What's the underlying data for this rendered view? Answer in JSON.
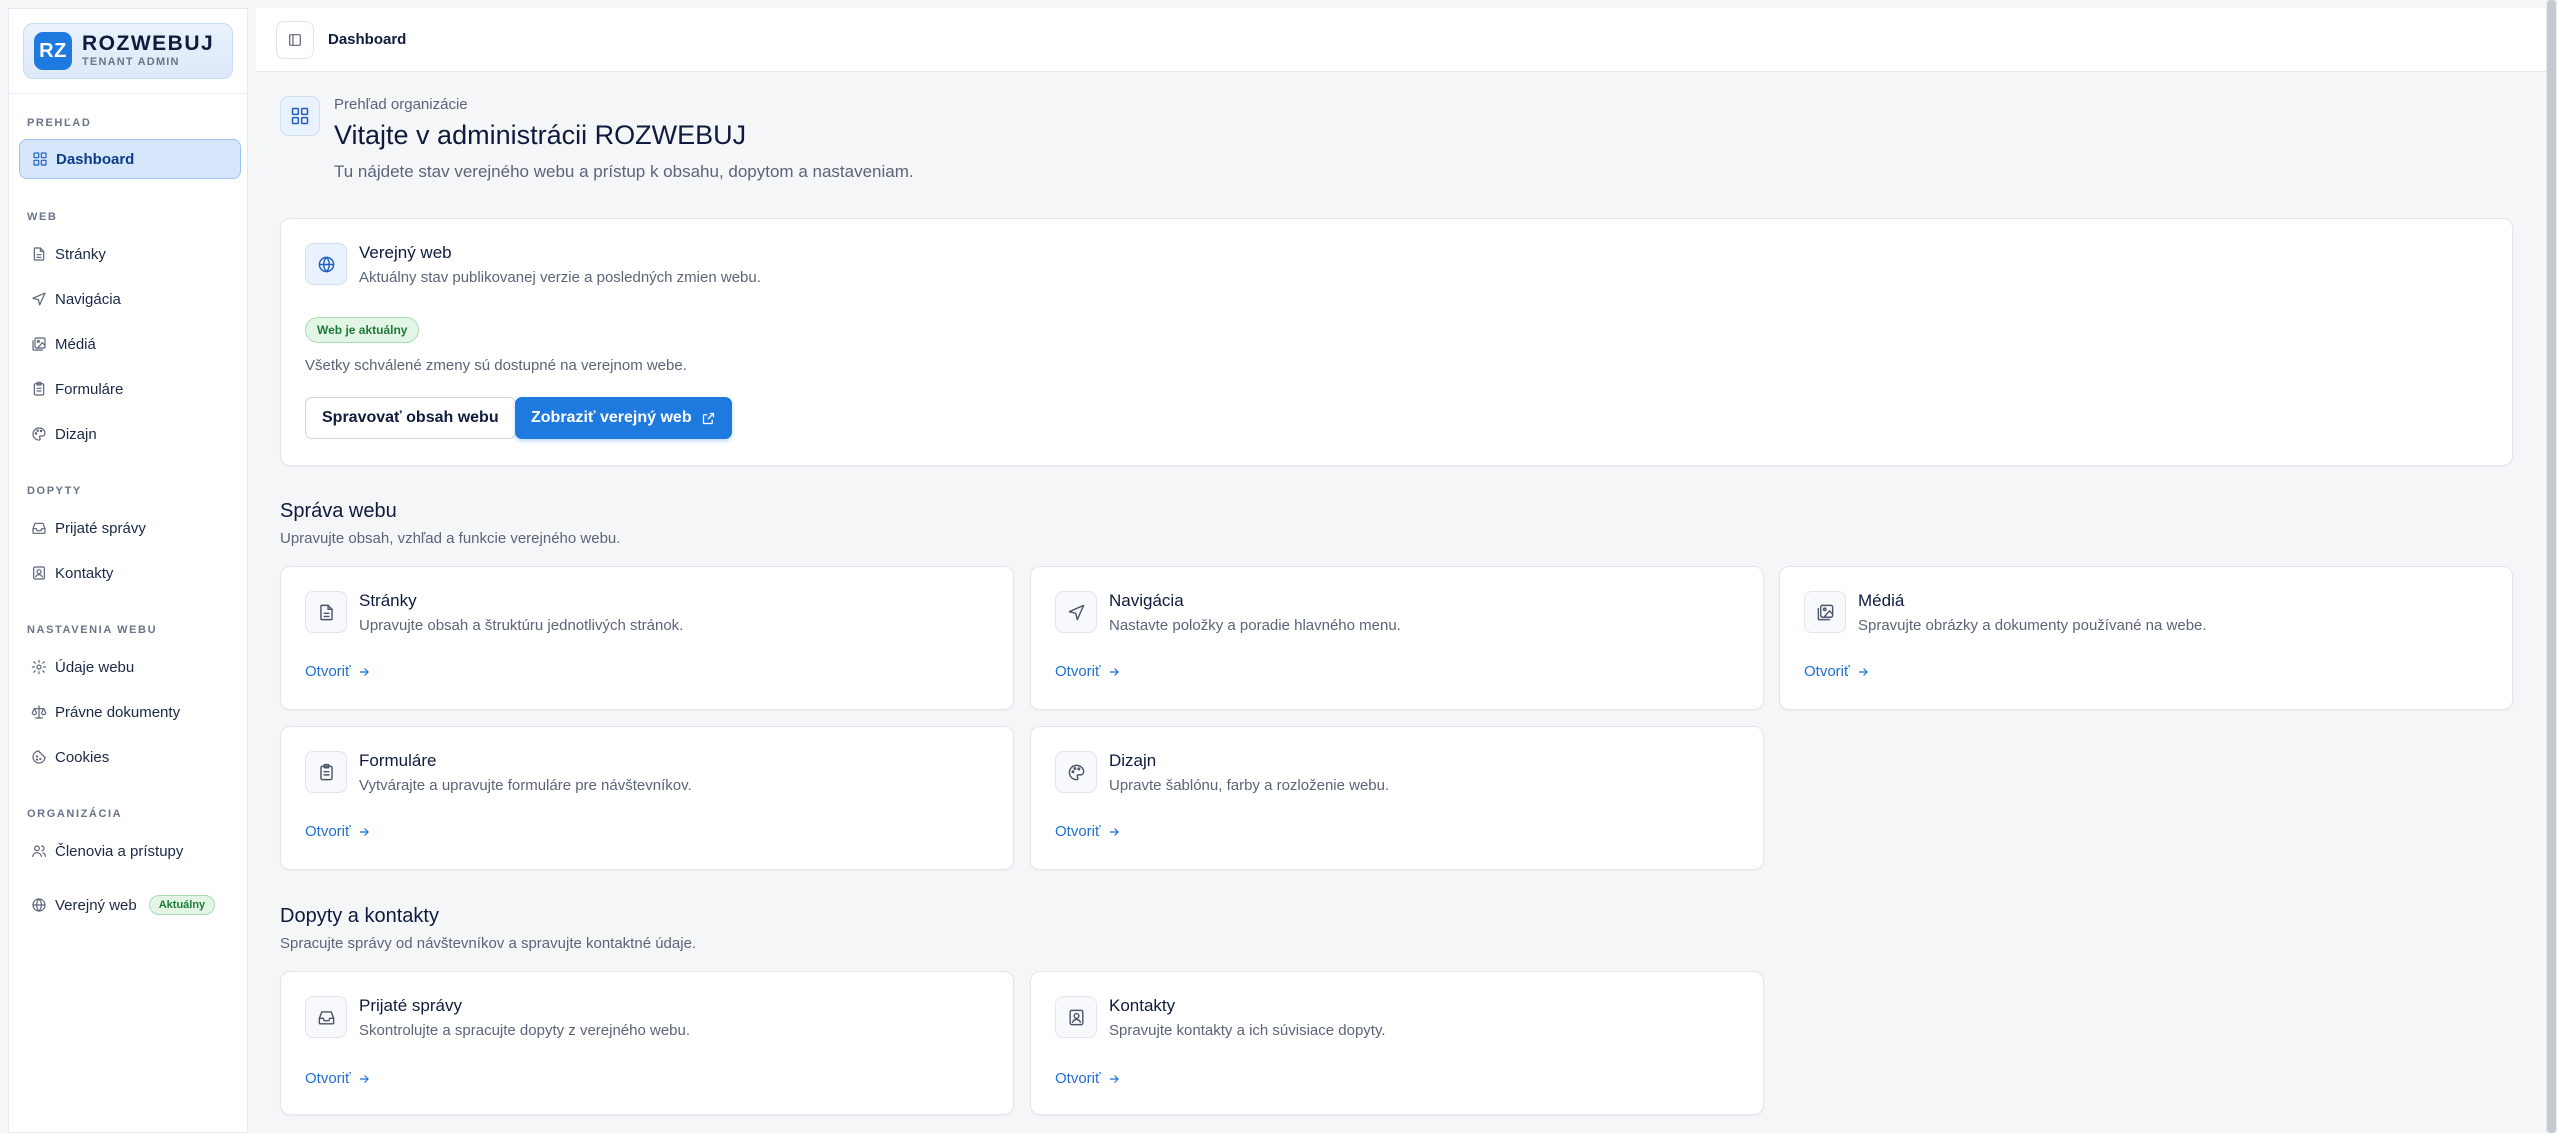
{
  "brand": {
    "logo": "RZ",
    "name": "ROZWEBUJ",
    "role": "TENANT ADMIN"
  },
  "sidebar": {
    "groups": [
      {
        "label": "PREHĽAD"
      },
      {
        "label": "WEB"
      },
      {
        "label": "DOPYTY"
      },
      {
        "label": "NASTAVENIA WEBU"
      },
      {
        "label": "ORGANIZÁCIA"
      }
    ],
    "items": [
      {
        "label": "Dashboard",
        "icon": "dashboard-grid-icon"
      },
      {
        "label": "Stránky",
        "icon": "file-icon"
      },
      {
        "label": "Navigácia",
        "icon": "navigation-icon"
      },
      {
        "label": "Médiá",
        "icon": "images-icon"
      },
      {
        "label": "Formuláre",
        "icon": "clipboard-icon"
      },
      {
        "label": "Dizajn",
        "icon": "palette-icon"
      },
      {
        "label": "Prijaté správy",
        "icon": "inbox-icon"
      },
      {
        "label": "Kontakty",
        "icon": "contact-icon"
      },
      {
        "label": "Údaje webu",
        "icon": "gear-icon"
      },
      {
        "label": "Právne dokumenty",
        "icon": "scale-icon"
      },
      {
        "label": "Cookies",
        "icon": "cookie-icon"
      },
      {
        "label": "Členovia a prístupy",
        "icon": "users-icon"
      },
      {
        "label": "Verejný web",
        "icon": "globe-icon",
        "badge": "Aktuálny"
      }
    ]
  },
  "topbar": {
    "title": "Dashboard"
  },
  "hero": {
    "eyebrow": "Prehľad organizácie",
    "title": "Vitajte v administrácii ROZWEBUJ",
    "subtitle": "Tu nájdete stav verejného webu a prístup k obsahu, dopytom a nastaveniam."
  },
  "public_web": {
    "title": "Verejný web",
    "desc": "Aktuálny stav publikovanej verzie a posledných zmien webu.",
    "status": "Web je aktuálny",
    "note": "Všetky schválené zmeny sú dostupné na verejnom webe.",
    "manage_label": "Spravovať obsah webu",
    "view_label": "Zobraziť verejný web"
  },
  "web_section": {
    "title": "Správa webu",
    "subtitle": "Upravujte obsah, vzhľad a funkcie verejného webu.",
    "cards": [
      {
        "title": "Stránky",
        "desc": "Upravujte obsah a štruktúru jednotlivých stránok.",
        "link": "Otvoriť"
      },
      {
        "title": "Navigácia",
        "desc": "Nastavte položky a poradie hlavného menu.",
        "link": "Otvoriť"
      },
      {
        "title": "Médiá",
        "desc": "Spravujte obrázky a dokumenty používané na webe.",
        "link": "Otvoriť"
      },
      {
        "title": "Formuláre",
        "desc": "Vytvárajte a upravujte formuláre pre návštevníkov.",
        "link": "Otvoriť"
      },
      {
        "title": "Dizajn",
        "desc": "Upravte šablónu, farby a rozloženie webu.",
        "link": "Otvoriť"
      }
    ]
  },
  "inquiries_section": {
    "title": "Dopyty a kontakty",
    "subtitle": "Spracujte správy od návštevníkov a spravujte kontaktné údaje.",
    "cards": [
      {
        "title": "Prijaté správy",
        "desc": "Skontrolujte a spracujte dopyty z verejného webu.",
        "link": "Otvoriť"
      },
      {
        "title": "Kontakty",
        "desc": "Spravujte kontakty a ich súvisiace dopyty.",
        "link": "Otvoriť"
      }
    ]
  },
  "colors": {
    "accent": "#1f7ae0",
    "success": "#1e7a3a",
    "text": "#0f1b3d",
    "muted": "#5b6478"
  }
}
